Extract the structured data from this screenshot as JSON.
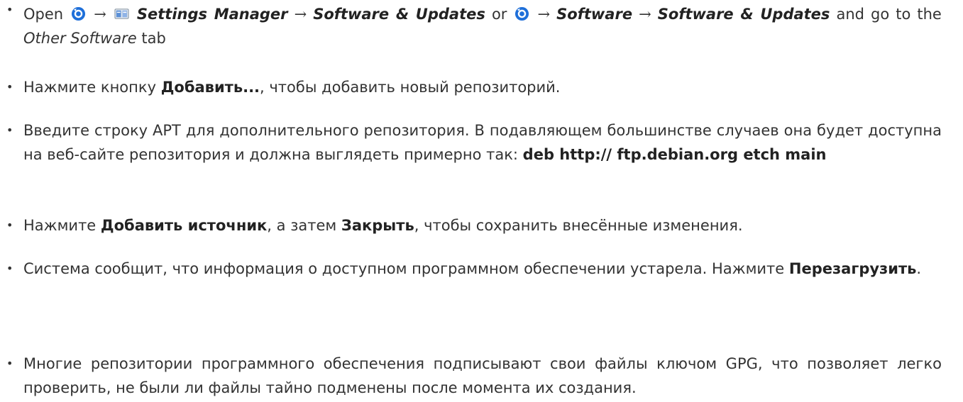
{
  "steps": [
    {
      "open": "Open",
      "arrow": "→",
      "settings_manager": "Settings Manager",
      "software_updates": "Software & Updates",
      "or": "or",
      "software": "Software",
      "and_go_to_the": "and go to the",
      "other_software": "Other Software",
      "tab": "tab"
    },
    {
      "pre": "Нажмите кнопку ",
      "bold": "Добавить...",
      "post": ", чтобы добавить новый репозиторий."
    },
    {
      "pre": "Введите строку APT для дополнительного репозитория. В подавляющем большинстве случаев она будет доступна на веб-сайте репозитория и должна выглядеть примерно так: ",
      "bold": "deb http:// ftp.debian.org etch main"
    },
    {
      "pre": "Нажмите ",
      "bold1": "Добавить источник",
      "mid": ", а затем ",
      "bold2": "Закрыть",
      "post": ", чтобы сохранить внесённые изменения."
    },
    {
      "pre": "Система сообщит, что информация о доступном программном обеспечении устарела. Нажмите ",
      "bold": "Перезагрузить",
      "post": "."
    },
    {
      "pre": "Многие репозитории программного обеспечения подписывают свои файлы ключом GPG, что позволяет легко проверить, не были ли файлы тайно подменены после момента их создания."
    }
  ],
  "bullet": "•",
  "icons": [
    "xfce-menu-icon",
    "settings-manager-icon",
    "xfce-menu-icon"
  ],
  "colors": {
    "text": "#333333",
    "icon_blue": "#1e6fd9"
  }
}
